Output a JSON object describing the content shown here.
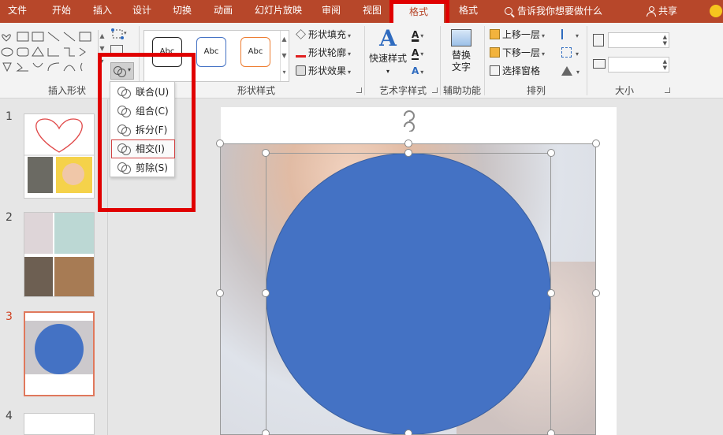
{
  "tabs": [
    {
      "label": "文件"
    },
    {
      "label": "开始"
    },
    {
      "label": "插入"
    },
    {
      "label": "设计"
    },
    {
      "label": "切换"
    },
    {
      "label": "动画"
    },
    {
      "label": "幻灯片放映"
    },
    {
      "label": "审阅"
    },
    {
      "label": "视图"
    },
    {
      "label": "格式",
      "active": true
    },
    {
      "label": "格式"
    }
  ],
  "tell_me": "告诉我你想要做什么",
  "share": "共享",
  "groups": {
    "insert_shapes": "插入形状",
    "shape_styles": "形状样式",
    "wordart": "艺术字样式",
    "accessibility": "辅助功能",
    "arrange": "排列",
    "size": "大小"
  },
  "style_thumbs": [
    "Abc",
    "Abc",
    "Abc"
  ],
  "shape_cmds": {
    "fill": "形状填充",
    "outline": "形状轮廓",
    "effects": "形状效果"
  },
  "quick_styles": "快速样式",
  "alt_text_line1": "替换",
  "alt_text_line2": "文字",
  "wordart_letter": "A",
  "arrange_cmds": {
    "bring_forward": "上移一层",
    "send_backward": "下移一层",
    "selection_pane": "选择窗格"
  },
  "merge_menu": [
    {
      "label": "联合(U)"
    },
    {
      "label": "组合(C)"
    },
    {
      "label": "拆分(F)"
    },
    {
      "label": "相交(I)",
      "hot": true
    },
    {
      "label": "剪除(S)"
    }
  ],
  "slides": [
    {
      "num": "1"
    },
    {
      "num": "2"
    },
    {
      "num": "3",
      "selected": true
    },
    {
      "num": "4"
    }
  ],
  "colors": {
    "ribbon_brand": "#b7472a",
    "circle_fill": "#4472c4",
    "annotation_red": "#e00000",
    "selected_thumb_border": "#e0785c"
  }
}
